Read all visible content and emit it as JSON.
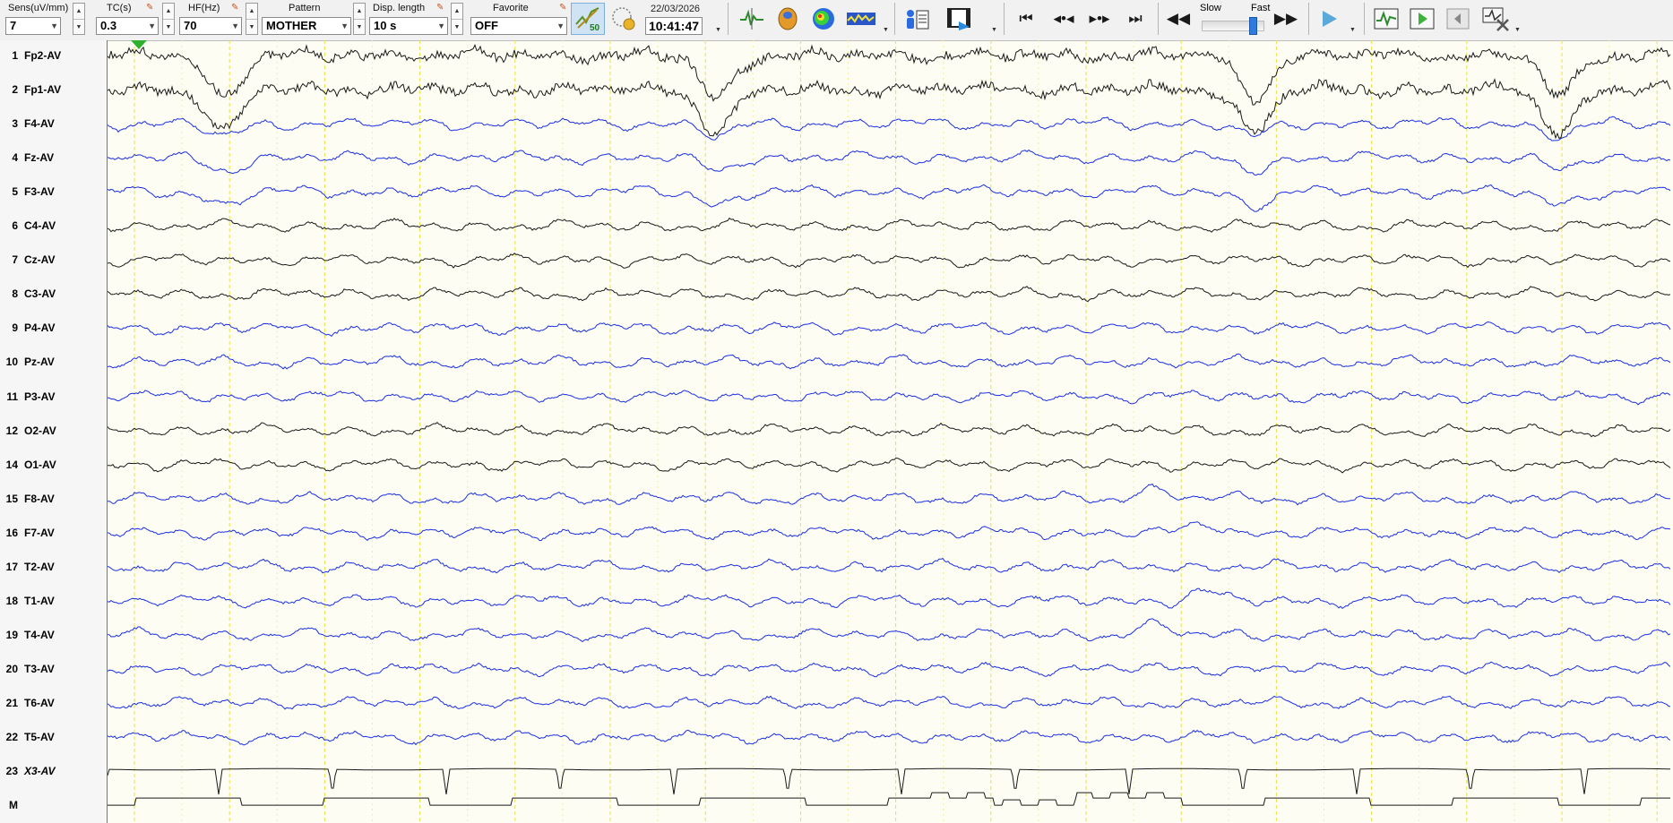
{
  "toolbar": {
    "sensitivity": {
      "label": "Sens(uV/mm)",
      "value": "7"
    },
    "time_constant": {
      "label": "TC(s)",
      "value": "0.3"
    },
    "high_filter": {
      "label": "HF(Hz)",
      "value": "70"
    },
    "pattern": {
      "label": "Pattern",
      "value": "MOTHER"
    },
    "display_length": {
      "label": "Disp. length",
      "value": "10 s"
    },
    "favorite": {
      "label": "Favorite",
      "value": "OFF"
    },
    "speed_badge": "50",
    "date": "22/03/2026",
    "time": "10:41:47",
    "speed_slow_label": "Slow",
    "speed_fast_label": "Fast",
    "speed_level": 0.85,
    "icons": [
      "wave-filter-icon",
      "settings-grid-icon",
      "spike-marker-icon",
      "head-map-icon",
      "topography-icon",
      "spectrum-icon",
      "patient-info-icon",
      "video-icon",
      "go-to-start-icon",
      "step-back-icon",
      "step-forward-icon",
      "go-to-end-icon",
      "rewind-icon",
      "fast-forward-icon",
      "play-icon",
      "trace-view-icon",
      "play-segment-icon",
      "collapse-panel-icon",
      "edit-tools-icon"
    ]
  },
  "channels": [
    {
      "num": "1",
      "name": "Fp2-AV",
      "color": "black"
    },
    {
      "num": "2",
      "name": "Fp1-AV",
      "color": "black"
    },
    {
      "num": "3",
      "name": "F4-AV",
      "color": "blue"
    },
    {
      "num": "4",
      "name": "Fz-AV",
      "color": "blue"
    },
    {
      "num": "5",
      "name": "F3-AV",
      "color": "blue"
    },
    {
      "num": "6",
      "name": "C4-AV",
      "color": "black"
    },
    {
      "num": "7",
      "name": "Cz-AV",
      "color": "black"
    },
    {
      "num": "8",
      "name": "C3-AV",
      "color": "black"
    },
    {
      "num": "9",
      "name": "P4-AV",
      "color": "blue"
    },
    {
      "num": "10",
      "name": "Pz-AV",
      "color": "blue"
    },
    {
      "num": "11",
      "name": "P3-AV",
      "color": "blue"
    },
    {
      "num": "12",
      "name": "O2-AV",
      "color": "black"
    },
    {
      "num": "14",
      "name": "O1-AV",
      "color": "black"
    },
    {
      "num": "15",
      "name": "F8-AV",
      "color": "blue"
    },
    {
      "num": "16",
      "name": "F7-AV",
      "color": "blue"
    },
    {
      "num": "17",
      "name": "T2-AV",
      "color": "blue"
    },
    {
      "num": "18",
      "name": "T1-AV",
      "color": "blue"
    },
    {
      "num": "19",
      "name": "T4-AV",
      "color": "blue"
    },
    {
      "num": "20",
      "name": "T3-AV",
      "color": "blue"
    },
    {
      "num": "21",
      "name": "T6-AV",
      "color": "blue"
    },
    {
      "num": "22",
      "name": "T5-AV",
      "color": "blue"
    },
    {
      "num": "23",
      "name": "X3-AV",
      "color": "black",
      "italic": true
    },
    {
      "num": "M",
      "name": "",
      "color": "black"
    }
  ],
  "colors": {
    "trace_black": "#1a1a1a",
    "trace_blue": "#1a2fe6",
    "grid_yellow": "#e6e24a",
    "background": "#fdfdf3",
    "marker_green": "#2fb12f"
  }
}
